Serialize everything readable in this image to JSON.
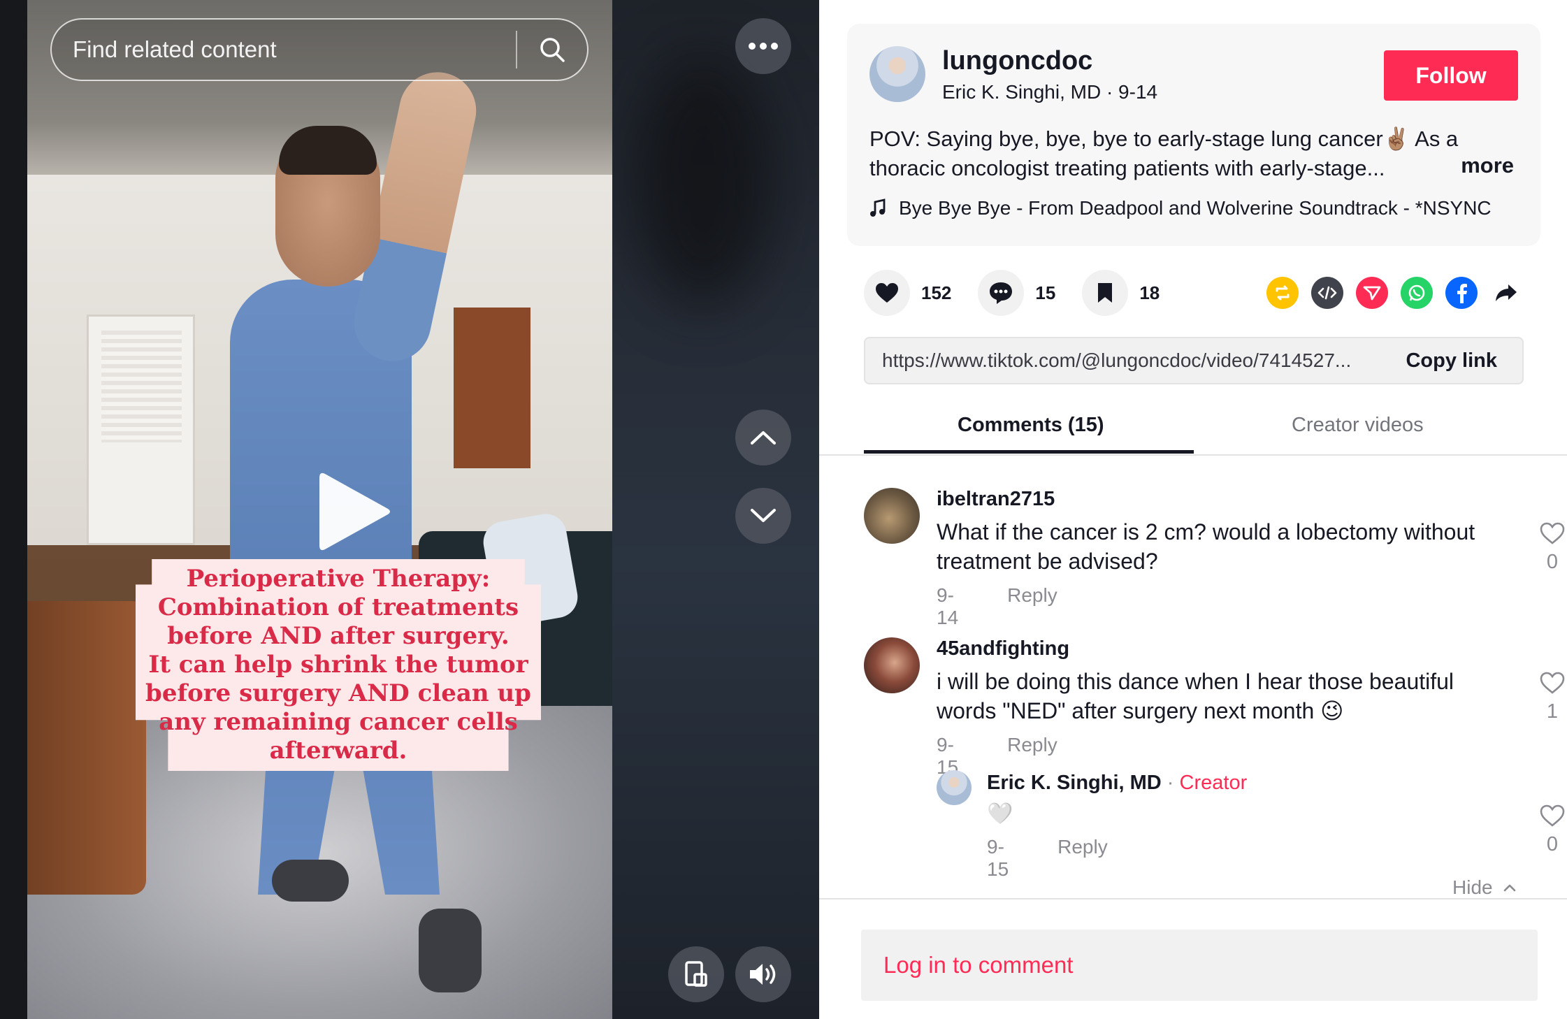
{
  "video": {
    "search_placeholder": "Find related content",
    "overlay_text": "Perioperative Therapy:\nCombination of treatments\nbefore AND after surgery.\nIt can help shrink the tumor\nbefore surgery AND clean up\nany remaining cancer cells\nafterward."
  },
  "post": {
    "username": "lungoncdoc",
    "display_name_date": "Eric K. Singhi, MD · 9-14",
    "follow_label": "Follow",
    "description": "POV: Saying bye, bye, bye to early-stage lung cancer✌🏽 As a thoracic oncologist treating patients with early-stage...",
    "more_label": "more",
    "music": "Bye Bye Bye - From Deadpool and Wolverine Soundtrack - *NSYNC"
  },
  "stats": {
    "likes": "152",
    "comments": "15",
    "saves": "18"
  },
  "share": {
    "url": "https://www.tiktok.com/@lungoncdoc/video/7414527...",
    "copy_label": "Copy link",
    "colors": {
      "repost": "#ffc300",
      "embed": "#41434c",
      "send": "#fe2c55",
      "whatsapp": "#25d366",
      "facebook": "#0866ff"
    }
  },
  "tabs": {
    "comments": "Comments (15)",
    "creator_videos": "Creator videos"
  },
  "comments": [
    {
      "user": "ibeltran2715",
      "text": "What if the cancer is 2 cm? would a lobectomy without treatment be advised?",
      "date": "9-14",
      "reply": "Reply",
      "likes": "0"
    },
    {
      "user": "45andfighting",
      "text": "i will be doing this dance when I hear those beautiful words \"NED\" after surgery next month 😉",
      "date": "9-15",
      "reply": "Reply",
      "likes": "1"
    }
  ],
  "reply": {
    "user": "Eric K. Singhi, MD",
    "separator": " · ",
    "badge": "Creator",
    "text": "🤍",
    "date": "9-15",
    "reply": "Reply",
    "likes": "0"
  },
  "hide_label": "Hide",
  "login_label": "Log in to comment",
  "accent": "#fe2c55"
}
